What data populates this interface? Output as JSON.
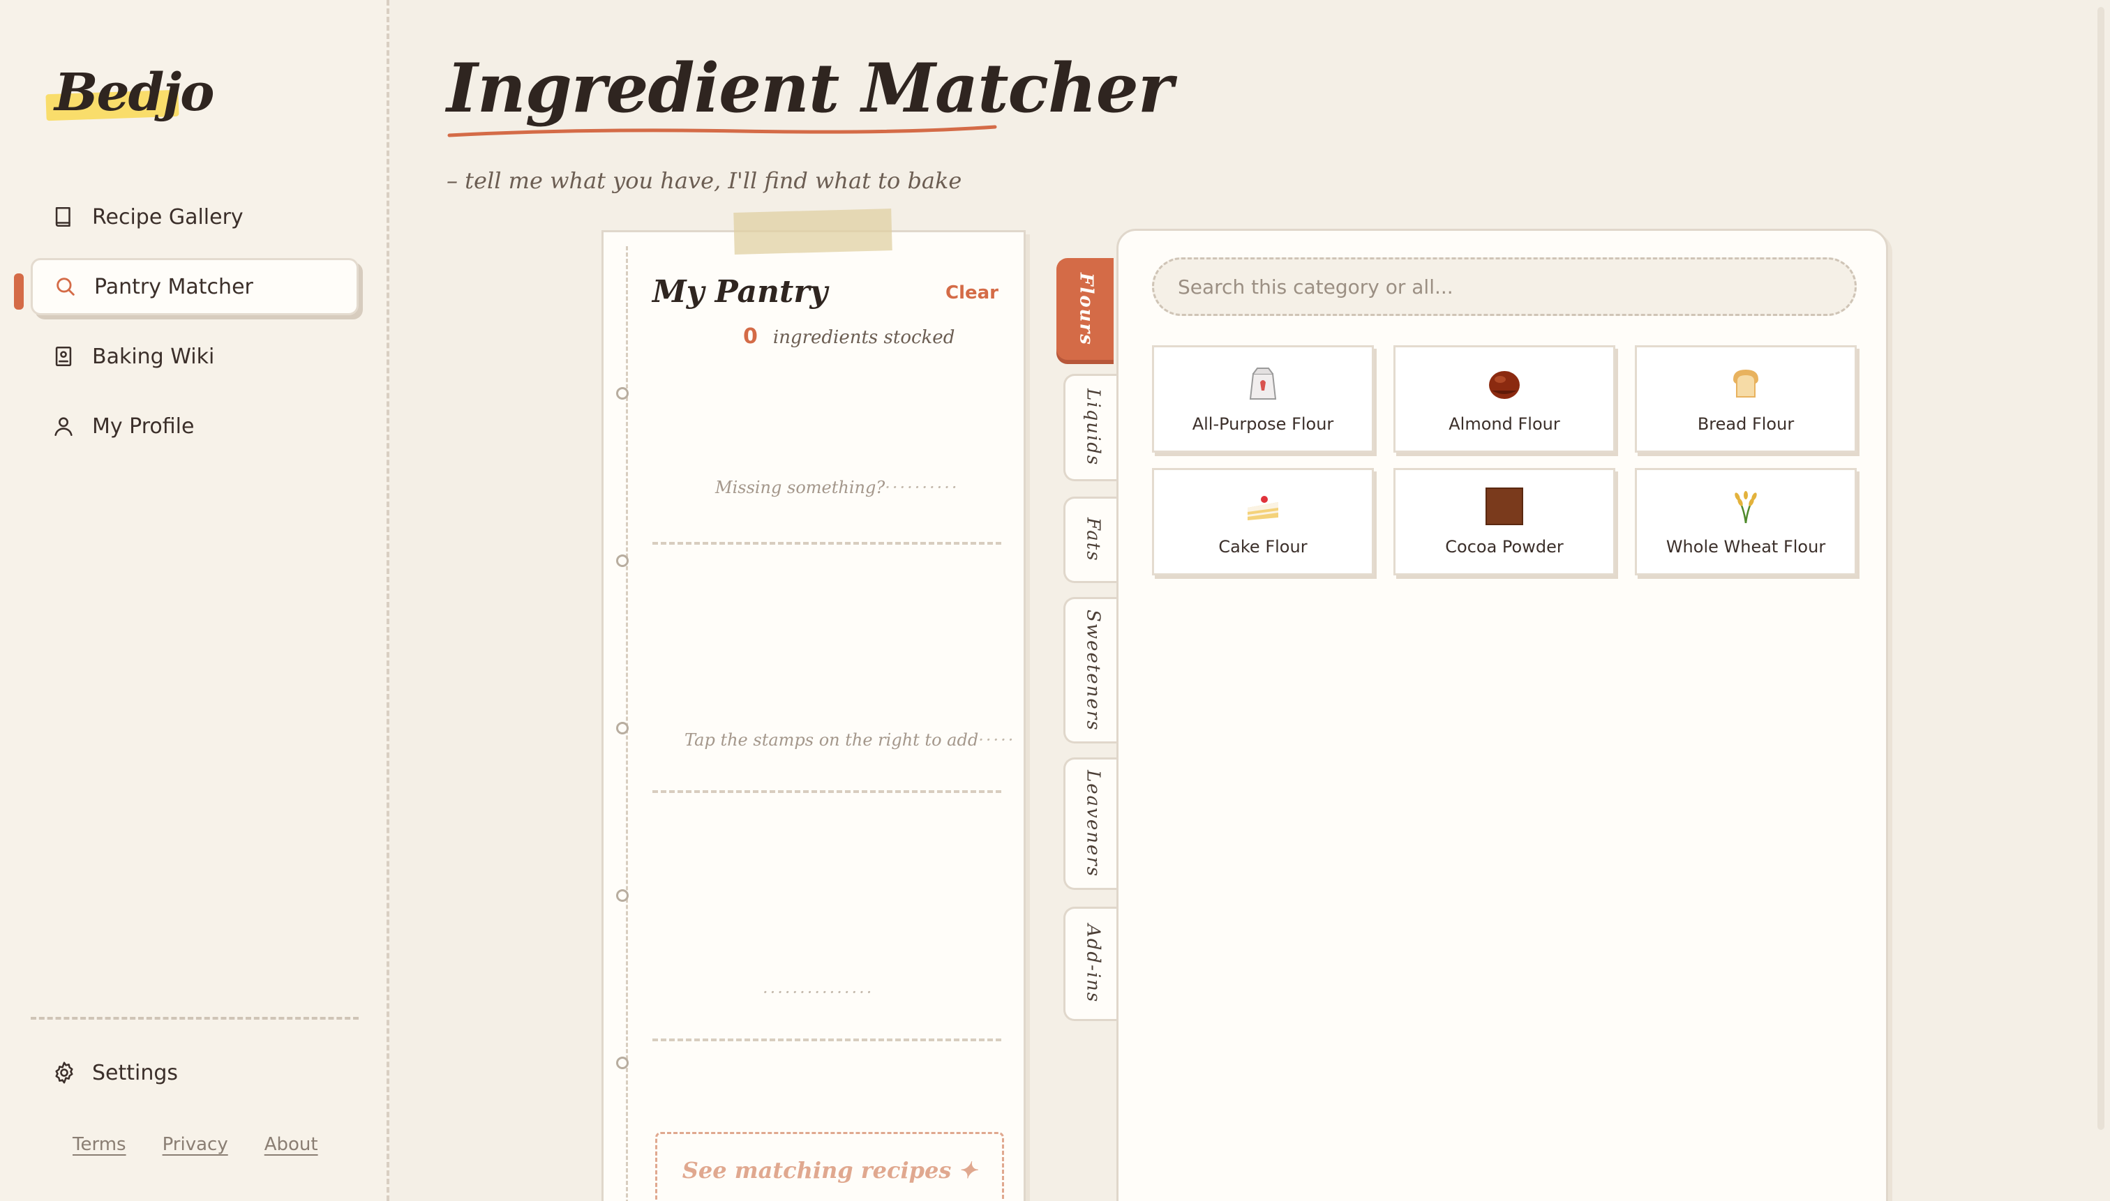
{
  "brand": {
    "logo": "Bedjo"
  },
  "sidebar": {
    "items": [
      {
        "label": "Recipe Gallery",
        "icon": "book-icon"
      },
      {
        "label": "Pantry Matcher",
        "icon": "search-icon",
        "active": true
      },
      {
        "label": "Baking Wiki",
        "icon": "wiki-book-icon"
      },
      {
        "label": "My Profile",
        "icon": "user-icon"
      }
    ],
    "settings": "Settings",
    "footer": [
      "Terms",
      "Privacy",
      "About"
    ]
  },
  "header": {
    "title": "Ingredient Matcher",
    "subtitle": "– tell me what you have, I'll find what to bake"
  },
  "pantry": {
    "title": "My Pantry",
    "clear": "Clear",
    "count": "0",
    "count_label": "ingredients stocked",
    "hint_1": "Missing something?",
    "hint_2": "Tap the stamps on the right to add",
    "cta": "See matching recipes",
    "cta_icon": "✦"
  },
  "tabs": [
    "Flours",
    "Liquids",
    "Fats",
    "Sweeteners",
    "Leaveners",
    "Add-ins"
  ],
  "search": {
    "placeholder": "Search this category or all..."
  },
  "ingredients": [
    {
      "name": "All-Purpose Flour",
      "icon": "flour-bag-icon"
    },
    {
      "name": "Almond Flour",
      "icon": "chestnut-icon"
    },
    {
      "name": "Bread Flour",
      "icon": "bread-icon"
    },
    {
      "name": "Cake Flour",
      "icon": "cake-icon"
    },
    {
      "name": "Cocoa Powder",
      "icon": "cocoa-square-icon"
    },
    {
      "name": "Whole Wheat Flour",
      "icon": "wheat-icon"
    }
  ],
  "colors": {
    "accent": "#d46b47",
    "paper": "#fffdf9",
    "background": "#f4efe6"
  }
}
